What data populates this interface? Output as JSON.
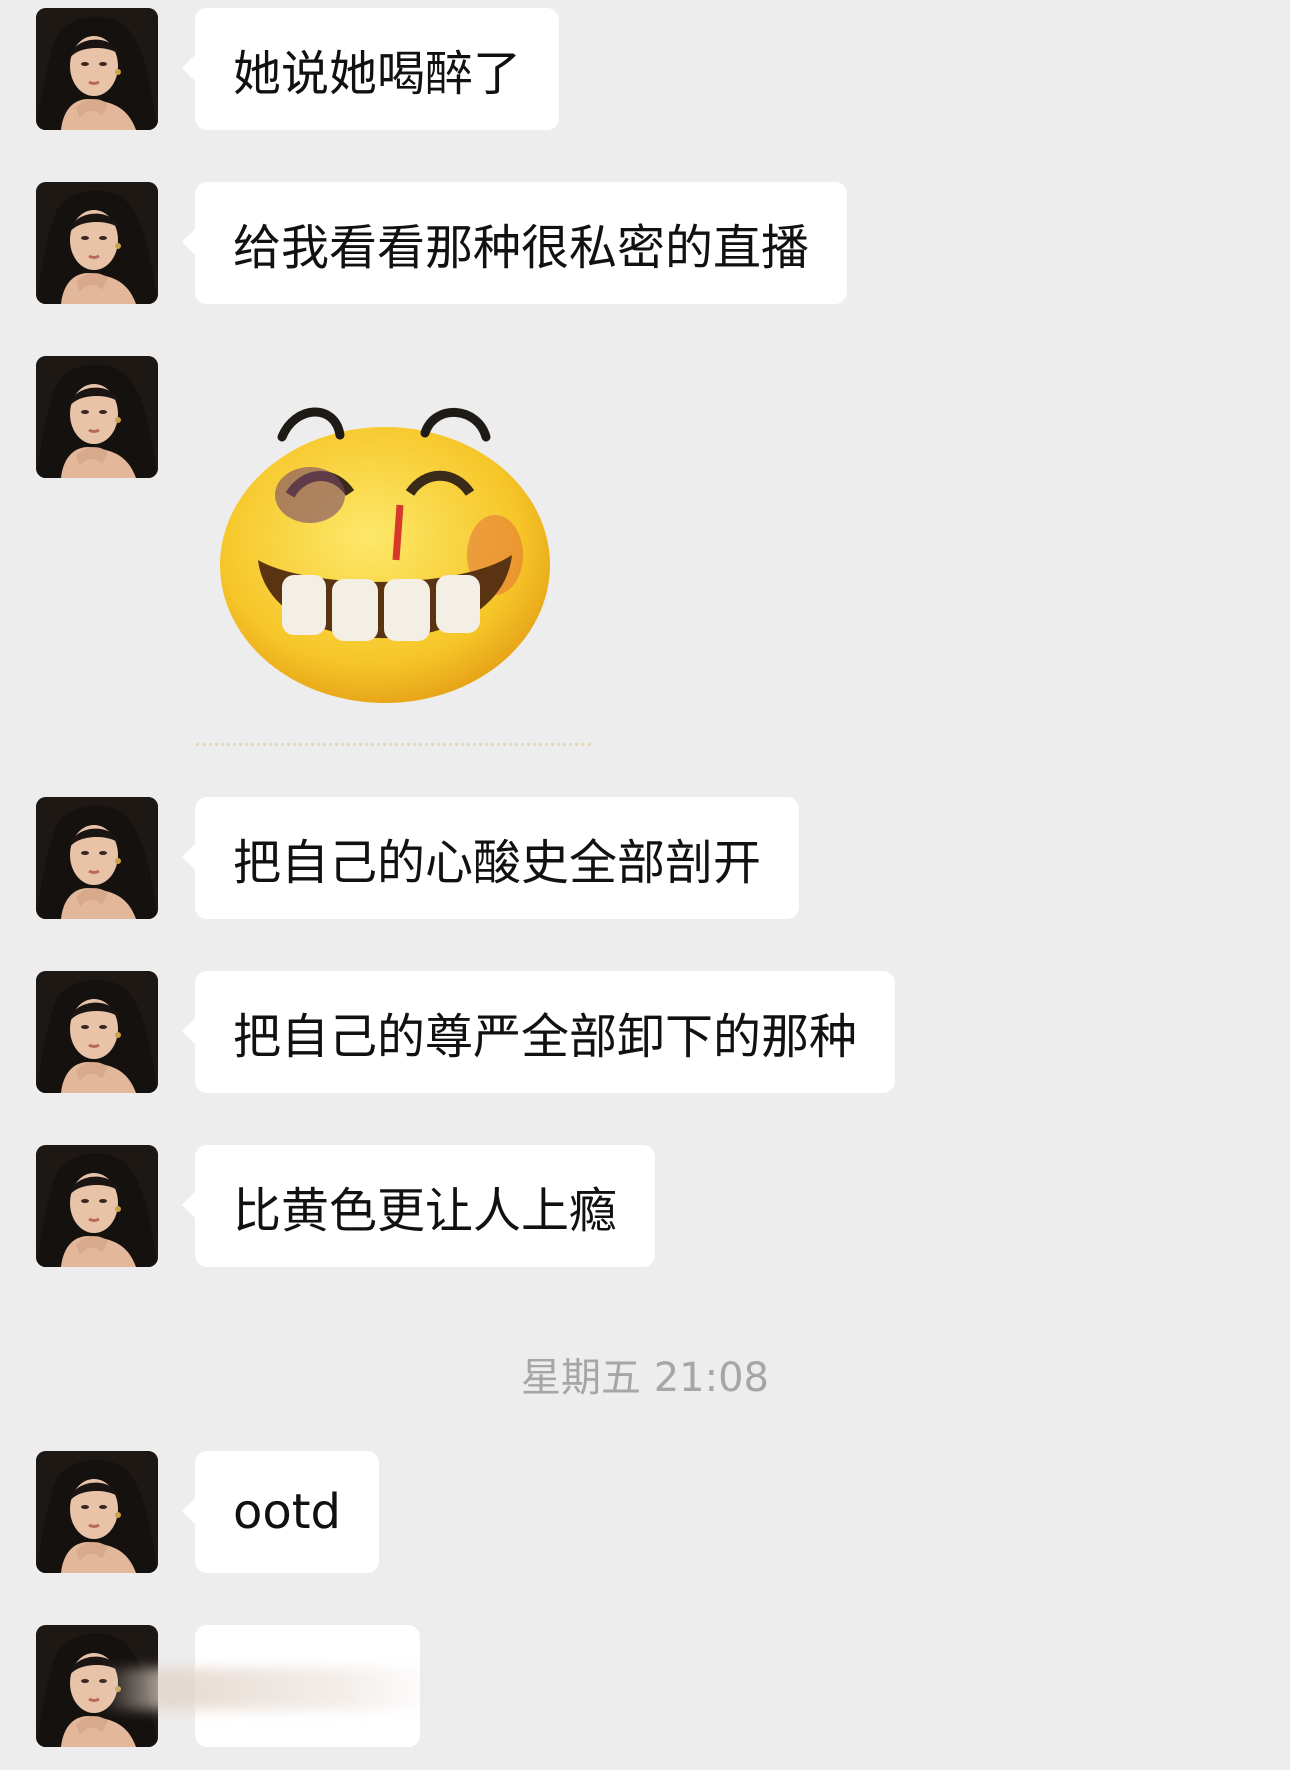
{
  "messages": [
    {
      "type": "text",
      "text": "她说她喝醉了"
    },
    {
      "type": "text",
      "text": "给我看看那种很私密的直播"
    },
    {
      "type": "sticker",
      "icon": "grinning-bruised-face-sticker"
    },
    {
      "type": "text",
      "text": "把自己的心酸史全部剖开"
    },
    {
      "type": "text",
      "text": "把自己的尊严全部卸下的那种"
    },
    {
      "type": "text",
      "text": "比黄色更让人上瘾"
    },
    {
      "type": "text",
      "text": "ootd"
    },
    {
      "type": "blurred",
      "text": ""
    }
  ],
  "timestamp": "星期五 21:08",
  "colors": {
    "background": "#ededed",
    "bubble": "#ffffff",
    "timestamp_text": "#a6a6a6"
  }
}
